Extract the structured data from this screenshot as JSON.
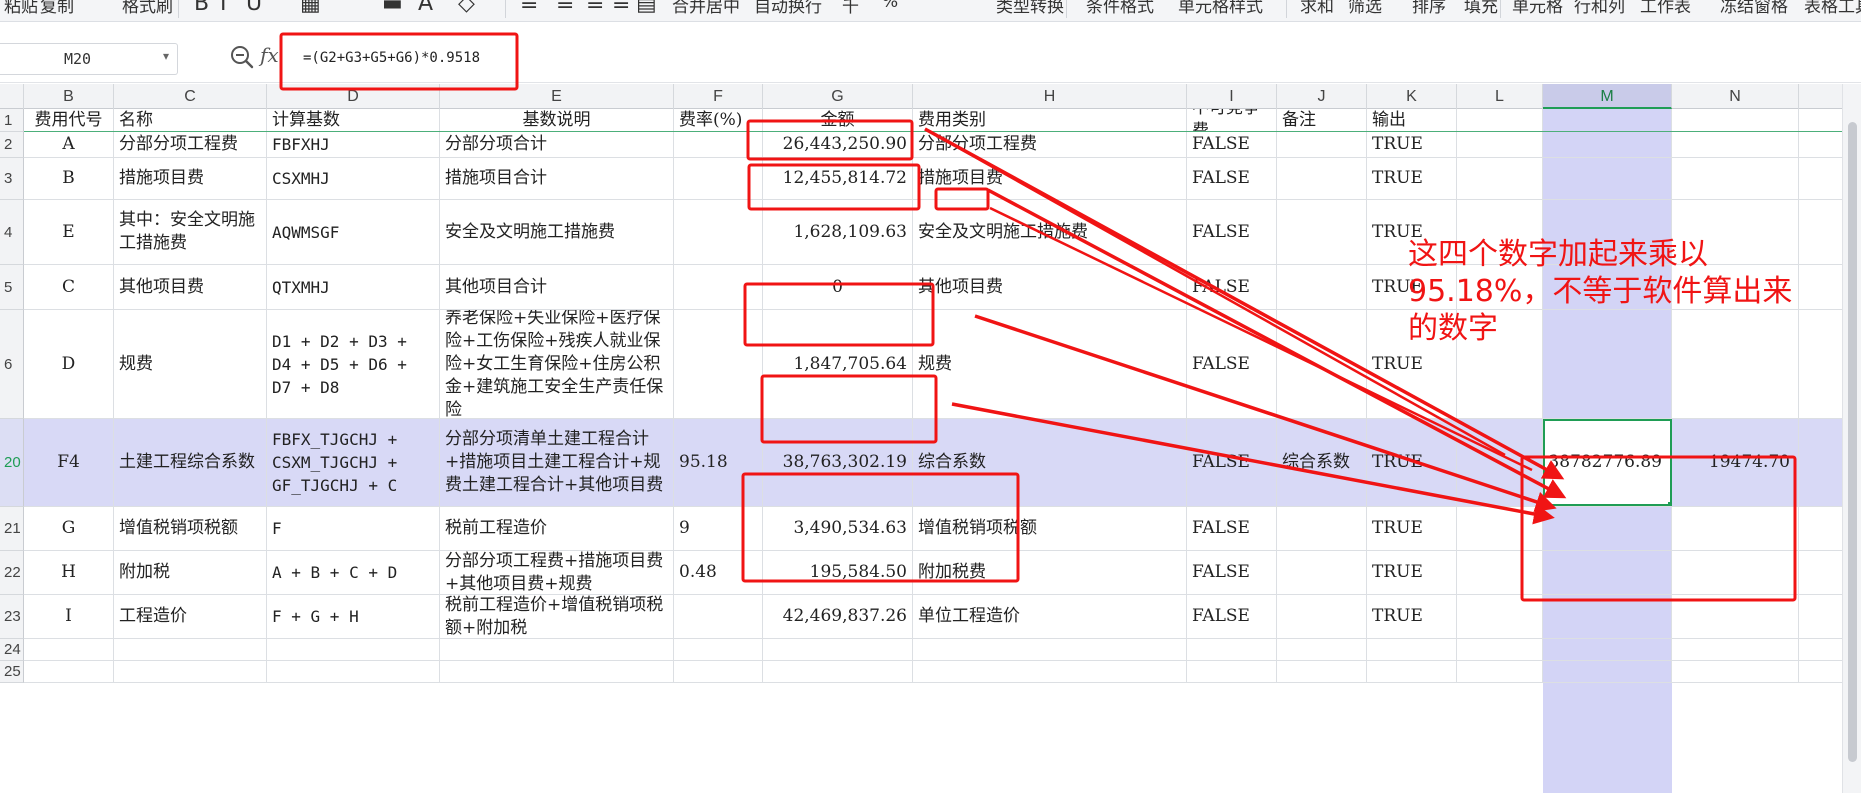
{
  "ribbon": {
    "items": [
      "粘贴",
      "复制",
      "格式刷",
      "合并居中",
      "自动换行",
      "千",
      "%",
      "类型转换",
      "条件格式",
      "单元格样式",
      "求和",
      "筛选",
      "排序",
      "填充",
      "单元格",
      "行和列",
      "工作表",
      "冻结窗格",
      "表格工具"
    ]
  },
  "formula_bar": {
    "cell_ref": "M20",
    "formula": "=(G2+G3+G5+G6)*0.9518"
  },
  "columns": [
    "B",
    "C",
    "D",
    "E",
    "F",
    "G",
    "H",
    "I",
    "J",
    "K",
    "L",
    "M",
    "N"
  ],
  "selected_column": "M",
  "header_row": {
    "row_no": "1",
    "cells": [
      "费用代号",
      "名称",
      "计算基数",
      "基数说明",
      "费率(%)",
      "金额",
      "费用类别",
      "不可竞争费",
      "备注",
      "输出",
      "",
      "",
      ""
    ]
  },
  "rows": [
    {
      "no": "2",
      "B": "A",
      "C": "分部分项工程费",
      "D": "FBFXHJ",
      "E": "分部分项合计",
      "F": "",
      "G": "26,443,250.90",
      "H": "分部分项工程费",
      "I": "FALSE",
      "J": "",
      "K": "TRUE",
      "L": "",
      "M": "",
      "N": ""
    },
    {
      "no": "3",
      "B": "B",
      "C": "措施项目费",
      "D": "CSXMHJ",
      "E": "措施项目合计",
      "F": "",
      "G": "12,455,814.72",
      "H": "措施项目费",
      "I": "FALSE",
      "J": "",
      "K": "TRUE",
      "L": "",
      "M": "",
      "N": ""
    },
    {
      "no": "4",
      "B": "E",
      "C": "其中：安全文明施工措施费",
      "D": "AQWMSGF",
      "E": "安全及文明施工措施费",
      "F": "",
      "G": "1,628,109.63",
      "H": "安全及文明施工措施费",
      "I": "FALSE",
      "J": "",
      "K": "TRUE",
      "L": "",
      "M": "",
      "N": ""
    },
    {
      "no": "5",
      "B": "C",
      "C": "其他项目费",
      "D": "QTXMHJ",
      "E": "其他项目合计",
      "F": "",
      "G": "0",
      "H": "其他项目费",
      "I": "FALSE",
      "J": "",
      "K": "TRUE",
      "L": "",
      "M": "",
      "N": ""
    },
    {
      "no": "6",
      "B": "D",
      "C": "规费",
      "D": "D1 + D2 + D3 + D4 + D5 + D6 + D7 + D8",
      "E": "养老保险+失业保险+医疗保险+工伤保险+残疾人就业保险+女工生育保险+住房公积金+建筑施工安全生产责任保险",
      "F": "",
      "G": "1,847,705.64",
      "H": "规费",
      "I": "FALSE",
      "J": "",
      "K": "TRUE",
      "L": "",
      "M": "",
      "N": ""
    },
    {
      "no": "20",
      "B": "F4",
      "C": "土建工程综合系数",
      "D": "FBFX_TJGCHJ + CSXM_TJGCHJ + GF_TJGCHJ + C",
      "E": "分部分项清单土建工程合计+措施项目土建工程合计+规费土建工程合计+其他项目费",
      "F": "95.18",
      "G": "38,763,302.19",
      "H": "综合系数",
      "I": "FALSE",
      "J": "综合系数",
      "K": "TRUE",
      "L": "",
      "M": "38782776.89",
      "N": "19474.70"
    },
    {
      "no": "21",
      "B": "G",
      "C": "增值税销项税额",
      "D": "F",
      "E": "税前工程造价",
      "F": "9",
      "G": "3,490,534.63",
      "H": "增值税销项税额",
      "I": "FALSE",
      "J": "",
      "K": "TRUE",
      "L": "",
      "M": "",
      "N": ""
    },
    {
      "no": "22",
      "B": "H",
      "C": "附加税",
      "D": "A + B + C + D",
      "E": "分部分项工程费+措施项目费+其他项目费+规费",
      "F": "0.48",
      "G": "195,584.50",
      "H": "附加税费",
      "I": "FALSE",
      "J": "",
      "K": "TRUE",
      "L": "",
      "M": "",
      "N": ""
    },
    {
      "no": "23",
      "B": "I",
      "C": "工程造价",
      "D": "F + G + H",
      "E": "税前工程造价+增值税销项税额+附加税",
      "F": "",
      "G": "42,469,837.26",
      "H": "单位工程造价",
      "I": "FALSE",
      "J": "",
      "K": "TRUE",
      "L": "",
      "M": "",
      "N": ""
    },
    {
      "no": "24",
      "B": "",
      "C": "",
      "D": "",
      "E": "",
      "F": "",
      "G": "",
      "H": "",
      "I": "",
      "J": "",
      "K": "",
      "L": "",
      "M": "",
      "N": ""
    },
    {
      "no": "25",
      "B": "",
      "C": "",
      "D": "",
      "E": "",
      "F": "",
      "G": "",
      "H": "",
      "I": "",
      "J": "",
      "K": "",
      "L": "",
      "M": "",
      "N": ""
    }
  ],
  "annotation": {
    "text": "这四个数字加起来乘以95.18%，不等于软件算出来的数字",
    "color": "#f01414"
  }
}
